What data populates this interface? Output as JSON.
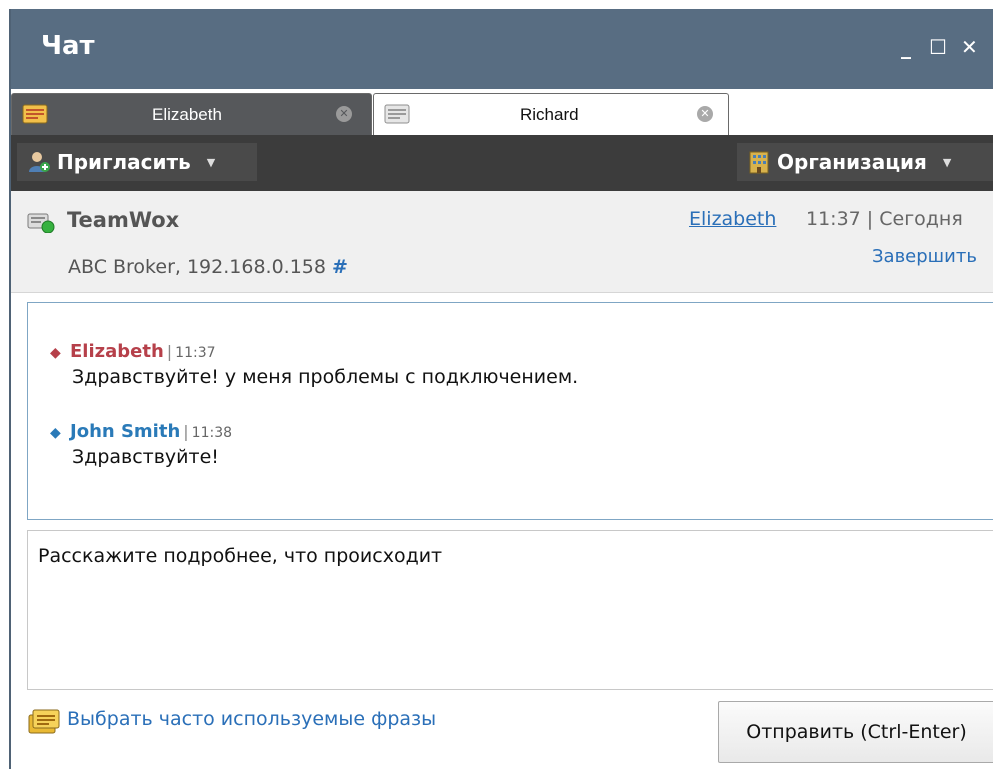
{
  "window": {
    "title": "Чат",
    "controls": {
      "minimize": "_",
      "maximize": "☐",
      "close": "✕"
    }
  },
  "tabs": [
    {
      "label": "Elizabeth",
      "active": false,
      "icon": "chat-window-icon"
    },
    {
      "label": "Richard",
      "active": true,
      "icon": "chat-window-icon"
    }
  ],
  "toolbar": {
    "invite_label": "Пригласить",
    "org_label": "Организация"
  },
  "session": {
    "app_name": "TeamWox",
    "client_info": "ABC Broker, 192.168.0.158",
    "hash": "#",
    "agent": "Elizabeth",
    "time_info": "11:37 | Сегодня",
    "finish_label": "Завершить"
  },
  "messages": [
    {
      "author": "Elizabeth",
      "time": "11:37",
      "text": "Здравствуйте! у меня проблемы с подключением.",
      "direction": "incoming"
    },
    {
      "author": "John Smith",
      "time": "11:38",
      "text": "Здравствуйте!",
      "direction": "outgoing"
    }
  ],
  "compose": {
    "value": "Расскажите подробнее, что происходит"
  },
  "phrases_label": "Выбрать часто используемые фразы",
  "send_label": "Отправить (Ctrl-Enter)",
  "colors": {
    "titlebar": "#586d82",
    "toolbar": "#3c3c3c",
    "link": "#2a6fb8",
    "incoming_author": "#b6404a",
    "outgoing_author": "#2a7ab8"
  }
}
